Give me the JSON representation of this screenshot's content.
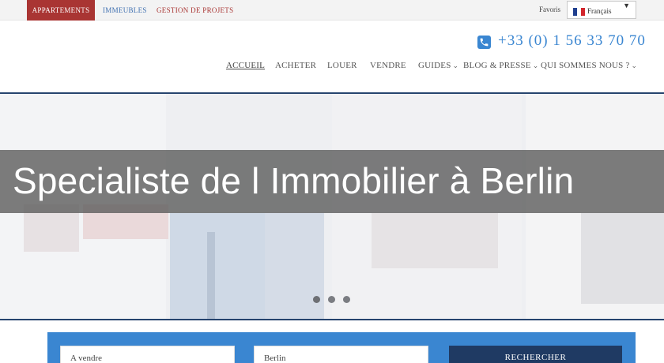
{
  "topbar": {
    "tabs": [
      {
        "label": "Appartements"
      },
      {
        "label": "Immeubles"
      },
      {
        "label": "Gestion de projets"
      }
    ],
    "favoris": "Favoris",
    "language": {
      "selected": "Français"
    }
  },
  "header": {
    "phone": "+33 (0) 1 56 33 70 70",
    "nav": [
      {
        "label": "Accueil"
      },
      {
        "label": "Acheter"
      },
      {
        "label": "Louer"
      },
      {
        "label": "Vendre"
      },
      {
        "label": "Guides"
      },
      {
        "label": "Blog & Presse"
      },
      {
        "label": "Qui sommes nous ?"
      }
    ]
  },
  "hero": {
    "title": "Specialiste de l Immobilier à Berlin",
    "slides": 3,
    "active_slide": 1
  },
  "search": {
    "type_value": "A vendre",
    "city_value": "Berlin",
    "button_label": "RECHERCHER"
  },
  "colors": {
    "brand_red": "#a93533",
    "accent_blue": "#3a86d1",
    "navy": "#1f3a63",
    "rule": "#26446e"
  },
  "icons": [
    "phone-icon",
    "chevron-down-icon",
    "flag-icon"
  ]
}
